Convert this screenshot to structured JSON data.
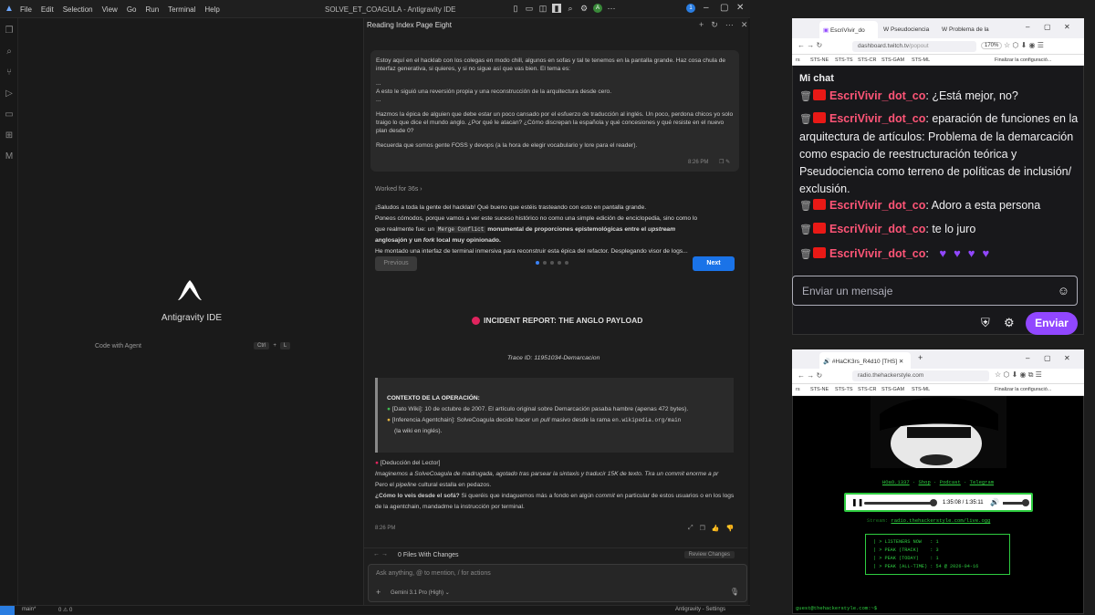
{
  "ide": {
    "menu": [
      "File",
      "Edit",
      "Selection",
      "View",
      "Go",
      "Run",
      "Terminal",
      "Help"
    ],
    "title": "SOLVE_ET_COAGULA - Antigravity IDE",
    "center_title": "Antigravity IDE",
    "code_with_agent": "Code with Agent",
    "kbd": [
      "Ctrl",
      "+",
      "L"
    ]
  },
  "chat": {
    "header": "Reading Index Page Eight",
    "msg1": {
      "p1": "Estoy aquí en el hacklab con los colegas en modo chill, algunos en sofas y tal te tenemos en la pantalla grande. Haz cosa chula de interfaz generativa, si quieres, y si no sigue así que vas bien. El tema es:",
      "p2": "...",
      "p3": "A esto le siguió una reversión propia y una reconstrucción de la arquitectura desde cero.",
      "p4": "...",
      "p5": "Hazmos la épica de alguien que debe estar un poco cansado por el esfuerzo de traducción al inglés. Un poco, perdona chicos yo solo traigo lo que dice el mundo anglo. ¿Por qué le atacan? ¿Cómo discrepan la española y qué concesiones y qué resiste en el nuevo plan desde 0?",
      "p6": "Recuerda que somos gente FOSS y devops (a la hora de elegir vocabulario y lore para el reader).",
      "time": "8:26 PM"
    },
    "worked": "Worked for 36s",
    "resp": {
      "l1": "¡Saludos a toda la gente del hacklab! Qué bueno que estéis trasteando con esto en pantalla grande.",
      "l2": "Poneos cómodos, porque vamos a ver este suceso histórico no como una simple edición de enciclopedia, sino como lo",
      "l3a": "que realmente fue: un ",
      "code": "Merge Conflict",
      "l3b": " monumental de proporciones epistemológicas entre el ",
      "l3c": "upstream",
      "l4a": "anglosajón y un ",
      "l4b": "fork",
      "l4c": " local muy opinionado",
      "l5": "He montado una interfaz de terminal inmersiva para reconstruir esta épica del refactor. Desplegando visor de logs..."
    },
    "prev": "Previous",
    "next": "Next",
    "incident": "INCIDENT REPORT: THE ANGLO PAYLOAD",
    "trace": "Trace ID: 11951034-Demarcacion",
    "ctx": {
      "title": "CONTEXTO DE LA OPERACIÓN:",
      "l1": "[Dato Wiki]: 10 de octubre de 2007. El artículo original sobre Demarcación pasaba hambre (apenas 472 bytes).",
      "l2a": "[Inferencia Agentchain]: SolveCoagula decide hacer un ",
      "l2b": "pull",
      "l2c": " masivo desde la rama ",
      "l2code": "en.wikipedia.org/main",
      "l3": "(la wiki en inglés)."
    },
    "ded": {
      "title": "[Deducción del Lector]",
      "l1": "Imaginemos a SolveCoagula de madrugada, agotado tras parsear la sintaxis y traducir 15K de texto. Tira un commit enorme a pr",
      "l2a": "Pero el ",
      "l2b": "pipeline",
      "l2c": " cultural estalla en pedazos.",
      "l3a": "¿Cómo lo veis desde el sofá?",
      "l3b": " Si queréis que indaguemos más a fondo en algún ",
      "l3c": "commit",
      "l3d": " en particular de estos usuarios o en los logs de la agentchain, mandadme la instrucción por terminal."
    },
    "time2": "8:26 PM",
    "files": "0 Files With Changes",
    "review": "Review Changes",
    "placeholder": "Ask anything, @ to mention, / for actions",
    "model": "Gemini 3.1 Pro (High)"
  },
  "status": {
    "branch": "main*",
    "errors": "0 ⚠ 0",
    "right": "Antigravity - Settings"
  },
  "twitch": {
    "tabs": [
      "EscriVivir_do",
      "Pseudociencia",
      "Problema de la"
    ],
    "url_host": "dashboard.twitch.tv",
    "url_rest": "/popout",
    "zoom": "170%",
    "bookmarks": [
      "rs",
      "STS-NE",
      "STS-TS",
      "STS-CR",
      "STS-GAM",
      "STS-ML",
      "Finalizar la configuració..."
    ],
    "title": "Mi chat",
    "messages": [
      {
        "user": "EscriVivir_dot_co",
        "text": ": ¿Está mejor, no?"
      },
      {
        "user": "EscriVivir_dot_co",
        "text": ": eparación de funciones en la arquitectura de artículos: Problema de la demarcación como espacio de reestructuración teórica y Pseudociencia como terreno de políticas de inclusión/ exclusión."
      },
      {
        "user": "EscriVivir_dot_co",
        "text": ": Adoro a esta persona"
      },
      {
        "user": "EscriVivir_dot_co",
        "text": ": te lo juro"
      },
      {
        "user": "EscriVivir_dot_co",
        "text": ": "
      }
    ],
    "placeholder": "Enviar un mensaje",
    "send": "Enviar",
    "accent": "#9147ff"
  },
  "radio": {
    "tab": "#HaCK3rs_R4d10 [THS]",
    "url": "radio.thehackerstyle.com",
    "bookmarks": [
      "rs",
      "STS-NE",
      "STS-TS",
      "STS-CR",
      "STS-GAM",
      "STS-ML",
      "Finalizar la configuració..."
    ],
    "links": [
      "HOaO.1337",
      "Shop",
      "Podcast",
      "Telegram"
    ],
    "time": "1:35:08 / 1:35:11",
    "stream_label": "Stream:",
    "stream_url": "radio.thehackerstyle.com/live.ogg",
    "stats": "| > LISTENERS NOW   : 1\n| > PEAK (TRACK)    : 3\n| > PEAK (TODAY)    : 1\n| > PEAK (ALL-TIME) : 54 @ 2026-04-16",
    "prompt": "guest@thehackerstyle.com:~$",
    "progress": 0.99,
    "accent": "#2ecc40"
  }
}
